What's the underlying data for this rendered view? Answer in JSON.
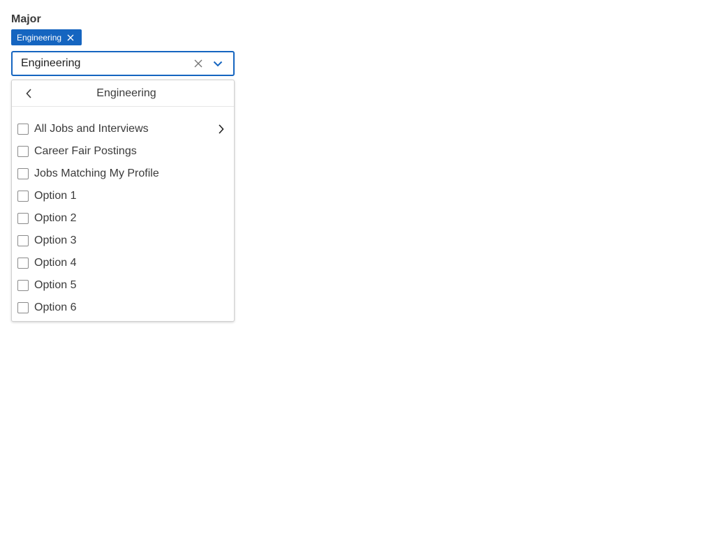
{
  "field": {
    "label": "Major",
    "chip": {
      "label": "Engineering"
    },
    "input": {
      "value": "Engineering",
      "placeholder": ""
    }
  },
  "menu": {
    "title": "Engineering",
    "items": [
      {
        "label": "All Jobs and Interviews",
        "checked": false,
        "has_children": true
      },
      {
        "label": "Career Fair Postings",
        "checked": false,
        "has_children": false
      },
      {
        "label": "Jobs Matching My Profile",
        "checked": false,
        "has_children": false
      },
      {
        "label": "Option 1",
        "checked": false,
        "has_children": false
      },
      {
        "label": "Option 2",
        "checked": false,
        "has_children": false
      },
      {
        "label": "Option 3",
        "checked": false,
        "has_children": false
      },
      {
        "label": "Option 4",
        "checked": false,
        "has_children": false
      },
      {
        "label": "Option 5",
        "checked": false,
        "has_children": false
      },
      {
        "label": "Option 6",
        "checked": false,
        "has_children": false
      }
    ]
  },
  "colors": {
    "accent": "#1565c0",
    "text": "#3a3a3a",
    "border": "#d0d0d0"
  },
  "icons": {
    "chip_remove": "close-icon",
    "clear": "close-icon",
    "dropdown": "chevron-down-icon",
    "back": "chevron-left-icon",
    "expand": "chevron-right-icon"
  }
}
